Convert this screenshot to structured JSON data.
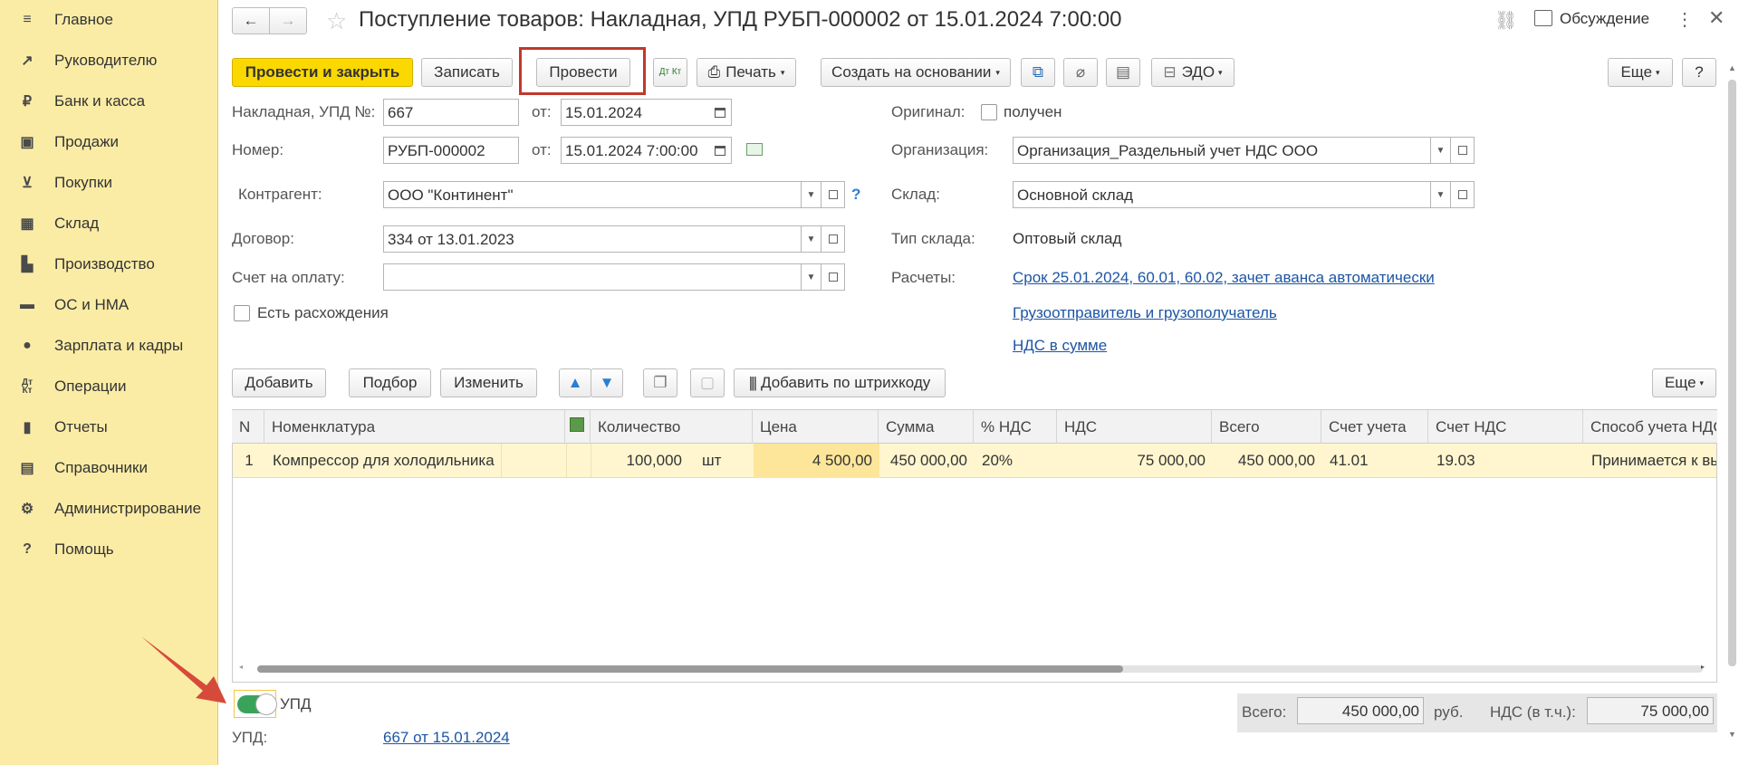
{
  "sidebar": {
    "items": [
      {
        "icon": "menu-icon",
        "label": "Главное"
      },
      {
        "icon": "trend-icon",
        "label": "Руководителю"
      },
      {
        "icon": "ruble-icon",
        "label": "Банк и касса"
      },
      {
        "icon": "bag-icon",
        "label": "Продажи"
      },
      {
        "icon": "cart-icon",
        "label": "Покупки"
      },
      {
        "icon": "warehouse-icon",
        "label": "Склад"
      },
      {
        "icon": "factory-icon",
        "label": "Производство"
      },
      {
        "icon": "truck-icon",
        "label": "ОС и НМА"
      },
      {
        "icon": "person-icon",
        "label": "Зарплата и кадры"
      },
      {
        "icon": "dt-kt-icon",
        "label": "Операции"
      },
      {
        "icon": "bar-chart-icon",
        "label": "Отчеты"
      },
      {
        "icon": "book-icon",
        "label": "Справочники"
      },
      {
        "icon": "gear-icon",
        "label": "Администрирование"
      },
      {
        "icon": "question-icon",
        "label": "Помощь"
      }
    ]
  },
  "header": {
    "title": "Поступление товаров: Накладная, УПД РУБП-000002 от 15.01.2024 7:00:00",
    "discussion": "Обсуждение"
  },
  "toolbar": {
    "post_close": "Провести и закрыть",
    "save": "Записать",
    "post": "Провести",
    "dt_kt": "Дт Кт",
    "print": "Печать",
    "create_based": "Создать на основании",
    "edo": "ЭДО",
    "more": "Еще",
    "help": "?"
  },
  "form": {
    "invoice_label": "Накладная, УПД №:",
    "invoice_number": "667",
    "from_label": "от:",
    "invoice_date": "15.01.2024",
    "number_label": "Номер:",
    "number": "РУБП-000002",
    "number_date": "15.01.2024  7:00:00",
    "counterparty_label": "Контрагент:",
    "counterparty": "ООО \"Континент\"",
    "contract_label": "Договор:",
    "contract": "334 от 13.01.2023",
    "payment_label": "Счет на оплату:",
    "payment": "",
    "discrepancy_label": "Есть расхождения",
    "original_label": "Оригинал:",
    "original_value": "получен",
    "org_label": "Организация:",
    "org": "Организация_Раздельный учет НДС ООО",
    "warehouse_label": "Склад:",
    "warehouse": "Основной склад",
    "warehouse_type_label": "Тип склада:",
    "warehouse_type": "Оптовый склад",
    "settlements_label": "Расчеты:",
    "settlements_link": "Срок 25.01.2024, 60.01, 60.02, зачет аванса автоматически",
    "shipper_link": "Грузоотправитель и грузополучатель",
    "vat_link": "НДС в сумме"
  },
  "table_toolbar": {
    "add": "Добавить",
    "select": "Подбор",
    "change": "Изменить",
    "barcode": "Добавить по штрихкоду",
    "more": "Еще"
  },
  "table": {
    "columns": [
      "N",
      "Номенклатура",
      "Количество",
      "Цена",
      "Сумма",
      "% НДС",
      "НДС",
      "Всего",
      "Счет учета",
      "Счет НДС",
      "Способ учета НДС"
    ],
    "rows": [
      {
        "n": "1",
        "item": "Компрессор для холодильника",
        "qty": "100,000",
        "unit": "шт",
        "price": "4 500,00",
        "sum": "450 000,00",
        "vat_rate": "20%",
        "vat": "75 000,00",
        "total": "450 000,00",
        "account": "41.01",
        "vat_account": "19.03",
        "vat_method": "Принимается к вычету"
      }
    ]
  },
  "footer": {
    "upd_toggle": "УПД",
    "upd_label": "УПД:",
    "upd_link": "667 от 15.01.2024",
    "total_label": "Всего:",
    "total": "450 000,00",
    "currency": "руб.",
    "vat_label": "НДС (в т.ч.):",
    "vat": "75 000,00"
  },
  "colors": {
    "accent_yellow": "#fbd800",
    "sidebar_bg": "#fbeca5",
    "highlight_red": "#c0392b",
    "toggle_green": "#3aa35b",
    "link_blue": "#1c55a5",
    "row_highlight": "#fff6cf"
  }
}
